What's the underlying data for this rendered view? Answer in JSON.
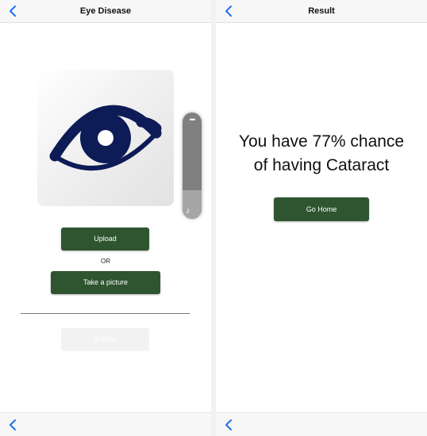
{
  "left_screen": {
    "title": "Eye Disease",
    "upload_label": "Upload",
    "or_label": "OR",
    "take_picture_label": "Take a picture",
    "submit_label": "Submit",
    "floating_menu_dots": "•••",
    "floating_menu_icon": "♪"
  },
  "right_screen": {
    "title": "Result",
    "result_line1": "You have 77% chance",
    "result_line2": "of having Cataract",
    "go_home_label": "Go Home"
  },
  "icons": {
    "back": "chevron-left-icon",
    "logo": "eye-icon",
    "floating_menu": "more-icon",
    "floating_audio": "music-note-icon"
  },
  "colors": {
    "accent_blue": "#1a73e8",
    "button_green": "#2e5530",
    "eye_navy": "#0d1b57"
  }
}
